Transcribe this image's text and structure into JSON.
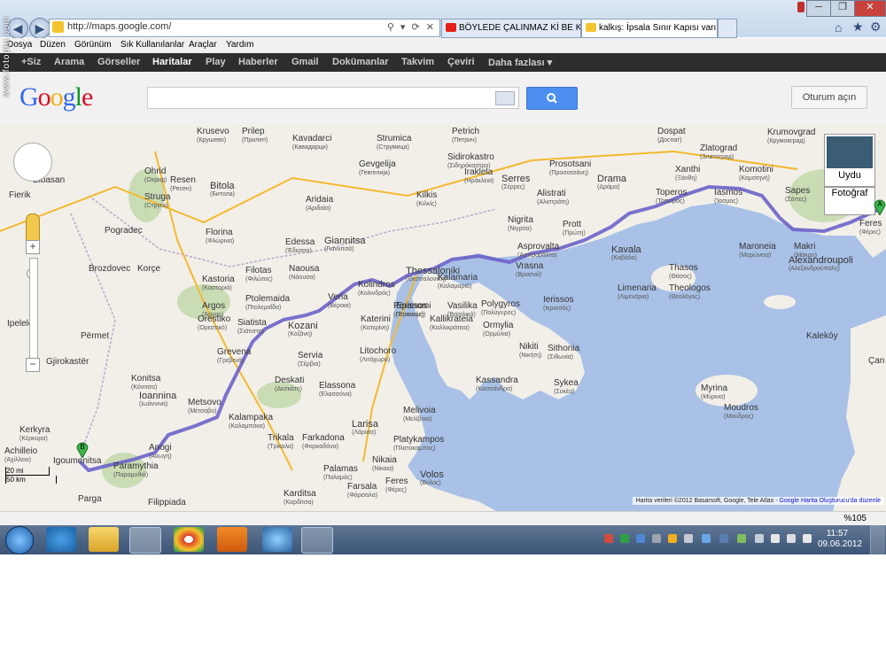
{
  "browser": {
    "url": "http://maps.google.com/",
    "tabs": [
      {
        "label": "BÖYLEDE ÇALINMAZ Kİ BE KA...",
        "icon": "youtube-icon"
      },
      {
        "label": "kalkış: İpsala Sınır Kapısı varı...",
        "icon": "google-maps-icon",
        "active": true
      }
    ],
    "menu": [
      "Dosya",
      "Düzen",
      "Görünüm",
      "Sık Kullanılanlar",
      "Araçlar",
      "Yardım"
    ],
    "zoom": "%105",
    "watermark": "www.fotoptu.com"
  },
  "google_bar": {
    "items": [
      "+Siz",
      "Arama",
      "Görseller",
      "Haritalar",
      "Play",
      "Haberler",
      "Gmail",
      "Dokümanlar",
      "Takvim",
      "Çeviri",
      "Daha fazlası ▾"
    ],
    "active": "Haritalar"
  },
  "header": {
    "logo": "Google",
    "search_value": "",
    "signin_label": "Oturum açın"
  },
  "map": {
    "satellite_label": "Uydu",
    "photo_label": "Fotoğraf",
    "scale_mi": "20 mi",
    "scale_km": "50 km",
    "copyright": "Harita verileri ©2012 Basarsoft, Google, Tele Atlas - ",
    "feedback_link": "Google Harita Oluşturucu'da düzenle",
    "marker_a": "A",
    "marker_b": "B",
    "places": [
      {
        "name": "Krusevo",
        "gr": "(Крушево)"
      },
      {
        "name": "Prilep",
        "gr": "(Прилеп)"
      },
      {
        "name": "Kavadarci",
        "gr": "(Кавадарци)"
      },
      {
        "name": "Strumica",
        "gr": "(Струмица)"
      },
      {
        "name": "Petrich",
        "gr": "(Петрич)"
      },
      {
        "name": "Dospat",
        "gr": "(Доспат)"
      },
      {
        "name": "Krumovgrad",
        "gr": "(Крумовград)"
      },
      {
        "name": "Sidirokastro",
        "gr": "(Σιδηρόκαστρο)"
      },
      {
        "name": "Ohrid",
        "gr": "(Охрид)"
      },
      {
        "name": "Resen",
        "gr": "(Ресен)"
      },
      {
        "name": "Bitola",
        "gr": "(Битола)"
      },
      {
        "name": "Gevgelija",
        "gr": "(Гевгелија)"
      },
      {
        "name": "Prosotsani",
        "gr": "(Προσοτσάνη)"
      },
      {
        "name": "Zlatograd",
        "gr": "(Златоград)"
      },
      {
        "name": "Elbasan",
        "gr": ""
      },
      {
        "name": "Struga",
        "gr": "(Струга)"
      },
      {
        "name": "Iraklela",
        "gr": "(Ηράκλεια)"
      },
      {
        "name": "Serres",
        "gr": "(Σέρρες)"
      },
      {
        "name": "Drama",
        "gr": "(Δράμα)"
      },
      {
        "name": "Xanthi",
        "gr": "(Ξάνθη)"
      },
      {
        "name": "Komotini",
        "gr": "(Κομοτηνή)"
      },
      {
        "name": "Fierik",
        "gr": ""
      },
      {
        "name": "Pogradec",
        "gr": ""
      },
      {
        "name": "Florina",
        "gr": "(Φλώρινα)"
      },
      {
        "name": "Aridaia",
        "gr": "(Αριδαία)"
      },
      {
        "name": "Kilkis",
        "gr": "(Κιλκίς)"
      },
      {
        "name": "Alistrati",
        "gr": "(Αλιστράτη)"
      },
      {
        "name": "Toperos",
        "gr": "(Τόπειρος)"
      },
      {
        "name": "Iasmos",
        "gr": "(Ίασμος)"
      },
      {
        "name": "Sapes",
        "gr": "(Σάπες)"
      },
      {
        "name": "Nigrita",
        "gr": "(Νιγρίτα)"
      },
      {
        "name": "Edessa",
        "gr": "(Έδεσσα)"
      },
      {
        "name": "Giannitsa",
        "gr": "(Γιαννιτσά)"
      },
      {
        "name": "Prott",
        "gr": "(Πρώτη)"
      },
      {
        "name": "Kavala",
        "gr": "(Καβάλα)"
      },
      {
        "name": "Maroneia",
        "gr": "(Μαρώνεια)"
      },
      {
        "name": "Makri",
        "gr": "(Μάκρη)"
      },
      {
        "name": "Feres",
        "gr": "(Φέρες)"
      },
      {
        "name": "Alexandroupoli",
        "gr": "(Αλεξανδρούπολη)"
      },
      {
        "name": "Brozdovec",
        "gr": ""
      },
      {
        "name": "Korçe",
        "gr": ""
      },
      {
        "name": "Naousa",
        "gr": "(Νάουσα)"
      },
      {
        "name": "Thessaloniki",
        "gr": "(Θεσσαλονίκη)"
      },
      {
        "name": "Asprovalta",
        "gr": "(Ασπροβάλτα)"
      },
      {
        "name": "Thasos",
        "gr": "(Θάσος)"
      },
      {
        "name": "Kastoria",
        "gr": "(Καστοριά)"
      },
      {
        "name": "Filotas",
        "gr": "(Φιλώτας)"
      },
      {
        "name": "Veria",
        "gr": "(Βέροια)"
      },
      {
        "name": "Kolindros",
        "gr": "(Κολινδρός)"
      },
      {
        "name": "Kalamaria",
        "gr": "(Καλαμαριά)"
      },
      {
        "name": "Vrasna",
        "gr": "(Βρασνά)"
      },
      {
        "name": "Limenaria",
        "gr": "(Λιμενάρια)"
      },
      {
        "name": "Theologos",
        "gr": "(Θεολόγος)"
      },
      {
        "name": "Argos",
        "gr": "(Άργος)"
      },
      {
        "name": "Ptolemaida",
        "gr": "(Πτολεμαΐδα)"
      },
      {
        "name": "Orestiko",
        "gr": "(Ορεστικό)"
      },
      {
        "name": "Perissos",
        "gr": "(Περισσός)"
      },
      {
        "name": "Epanomi",
        "gr": "(Επανομή)"
      },
      {
        "name": "Vasilika",
        "gr": "(Βασιλικά)"
      },
      {
        "name": "Polygyros",
        "gr": "(Πολύγυρος)"
      },
      {
        "name": "Ierissos",
        "gr": "(Ιερισσός)"
      },
      {
        "name": "Ipelele",
        "gr": ""
      },
      {
        "name": "Siatista",
        "gr": "(Σιάτιστα)"
      },
      {
        "name": "Kozani",
        "gr": "(Κοζάνη)"
      },
      {
        "name": "Katerini",
        "gr": "(Κατερίνη)"
      },
      {
        "name": "Kallikrateia",
        "gr": "(Καλλικράτεια)"
      },
      {
        "name": "Ormylia",
        "gr": "(Ορμύλια)"
      },
      {
        "name": "Përmet",
        "gr": ""
      },
      {
        "name": "Servia",
        "gr": "(Σέρβια)"
      },
      {
        "name": "Kalekóy",
        "gr": ""
      },
      {
        "name": "Grevena",
        "gr": "(Γρεβενά)"
      },
      {
        "name": "Litochoro",
        "gr": "(Λιτόχωρο)"
      },
      {
        "name": "Nikiti",
        "gr": "(Νικήτη)"
      },
      {
        "name": "Sithonia",
        "gr": "(Σιθωνία)"
      },
      {
        "name": "Gjirokastër",
        "gr": ""
      },
      {
        "name": "Çan",
        "gr": ""
      },
      {
        "name": "Kassandra",
        "gr": "(Κασσάνδρα)"
      },
      {
        "name": "Sykea",
        "gr": "(Συκέα)"
      },
      {
        "name": "Konitsa",
        "gr": "(Κόνιτσα)"
      },
      {
        "name": "Deskati",
        "gr": "(Δεσκάτη)"
      },
      {
        "name": "Elassona",
        "gr": "(Ελασσόνα)"
      },
      {
        "name": "Myrina",
        "gr": "(Μύρινα)"
      },
      {
        "name": "Moudros",
        "gr": "(Μούδρος)"
      },
      {
        "name": "Ioannina",
        "gr": "(Ιωάννινα)"
      },
      {
        "name": "Metsovo",
        "gr": "(Μέτσοβο)"
      },
      {
        "name": "Kalampaka",
        "gr": "(Καλαμπάκα)"
      },
      {
        "name": "Larisa",
        "gr": "(Λάρισα)"
      },
      {
        "name": "Melivoia",
        "gr": "(Μελίβοια)"
      },
      {
        "name": "Kerkyra",
        "gr": "(Κέρκυρα)"
      },
      {
        "name": "Paramythia",
        "gr": "(Παραμυθιά)"
      },
      {
        "name": "Anogi",
        "gr": "(Ανωγή)"
      },
      {
        "name": "Trikala",
        "gr": "(Τρίκαλα)"
      },
      {
        "name": "Farkadona",
        "gr": "(Φαρκαδόνα)"
      },
      {
        "name": "Platykampos",
        "gr": "(Πλατύκαμπος)"
      },
      {
        "name": "Achilleio",
        "gr": "(Αχίλλειο)"
      },
      {
        "name": "Igoumenitsa",
        "gr": ""
      },
      {
        "name": "Palamas",
        "gr": "(Παλαμάς)"
      },
      {
        "name": "Nikaia",
        "gr": "(Νίκαια)"
      },
      {
        "name": "Volos",
        "gr": "(Βόλος)"
      },
      {
        "name": "Feres",
        "gr": "(Φέρες)"
      },
      {
        "name": "Parga",
        "gr": ""
      },
      {
        "name": "Filippiada",
        "gr": ""
      },
      {
        "name": "Karditsa",
        "gr": "(Καρδίτσα)"
      },
      {
        "name": "Farsala",
        "gr": "(Φάρσαλα)"
      }
    ]
  },
  "taskbar": {
    "time": "11:57",
    "date": "09.06.2012",
    "apps": [
      "start-orb",
      "google-earth-icon",
      "folder-icon",
      "ie-icon",
      "chrome-icon",
      "media-player-icon",
      "network-icon",
      "remote-desktop-icon"
    ]
  }
}
